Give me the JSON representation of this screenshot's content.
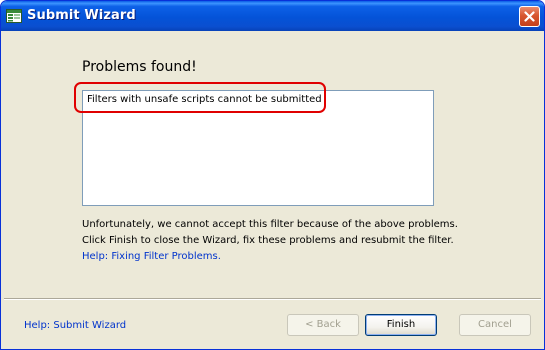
{
  "window": {
    "title": "Submit Wizard",
    "accent_color": "#0453d8"
  },
  "content": {
    "heading": "Problems found!",
    "problems": [
      "Filters with unsafe scripts cannot be submitted"
    ],
    "message": "Unfortunately, we cannot accept this filter because of the above problems. Click Finish to close the Wizard, fix these problems and resubmit the filter.",
    "help_link": "Help: Fixing Filter Problems."
  },
  "footer": {
    "help_link": "Help: Submit Wizard",
    "back_label": "< Back",
    "finish_label": "Finish",
    "cancel_label": "Cancel"
  },
  "icons": {
    "title": "wizard-window-icon",
    "close": "close-icon"
  },
  "highlight_color": "#e00000"
}
